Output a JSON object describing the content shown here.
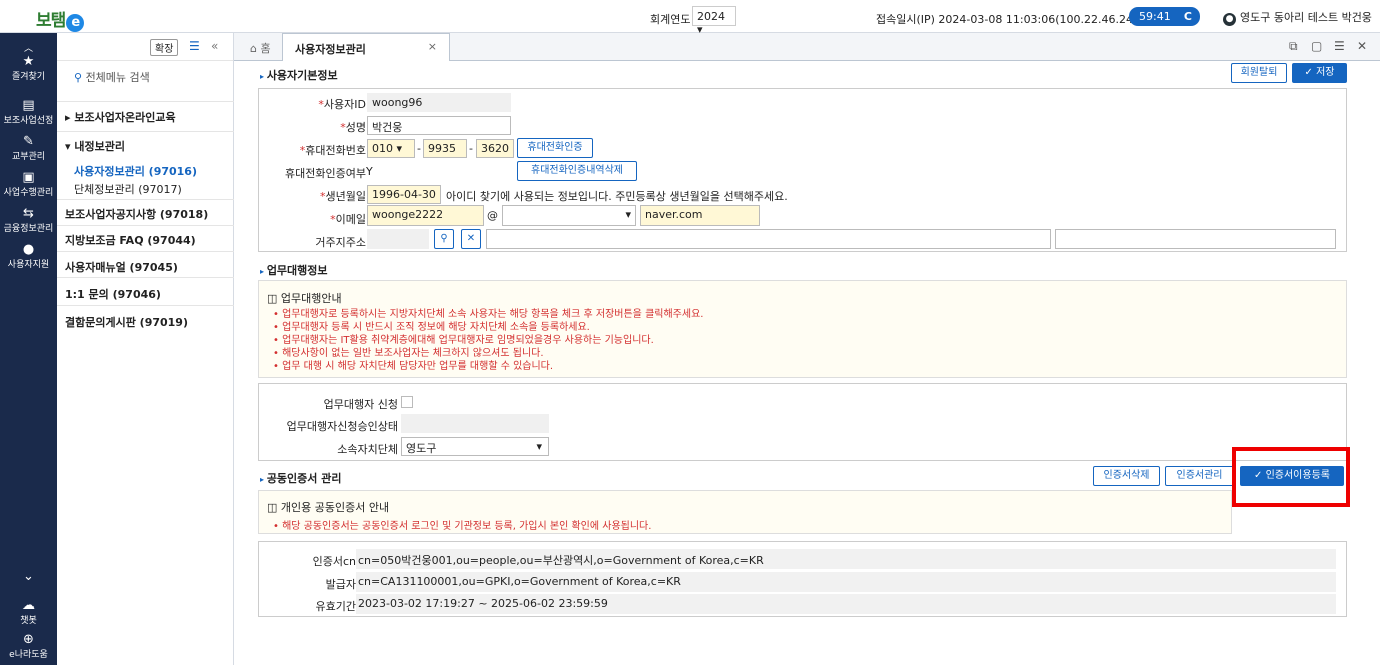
{
  "header": {
    "logo_text": "보탬",
    "logo_e": "e",
    "year_label": "회계연도",
    "year_value": "2024 ▾",
    "ip_info": "접속일시(IP)  2024-03-08 11:03:06(100.22.46.246)",
    "timer": "59:41",
    "timer_icon": "C",
    "user": "영도구 동아리 테스트 박건웅"
  },
  "leftbar": {
    "items": [
      {
        "label": "즐겨찾기",
        "icon": "★"
      },
      {
        "label": "보조사업선정",
        "icon": "▤"
      },
      {
        "label": "교부관리",
        "icon": "✎"
      },
      {
        "label": "사업수행관리",
        "icon": "▣"
      },
      {
        "label": "금융정보관리",
        "icon": "⇆"
      },
      {
        "label": "사용자지원",
        "icon": "●"
      }
    ],
    "down": "⌄",
    "chatbot": "챗봇",
    "help": "e나라도움"
  },
  "menu": {
    "expand": "확장",
    "search_placeholder": "전체메뉴 검색",
    "items": [
      "보조사업자온라인교육",
      "내정보관리",
      "사용자정보관리 (97016)",
      "단체정보관리 (97017)",
      "보조사업자공지사항 (97018)",
      "지방보조금 FAQ (97044)",
      "사용자매뉴얼 (97045)",
      "1:1 문의 (97046)",
      "결함문의게시판 (97019)"
    ]
  },
  "tabs": {
    "home": "홈",
    "active": "사용자정보관리",
    "close": "×"
  },
  "basic": {
    "title": "사용자기본정보",
    "withdraw": "회원탈퇴",
    "save": "✓ 저장",
    "labels": {
      "id": "사용자ID",
      "name": "성명",
      "phone": "휴대전화번호",
      "phone_verified": "휴대전화인증여부",
      "birth": "생년월일",
      "email": "이메일",
      "address": "거주지주소"
    },
    "id": "woong96",
    "name": "박건웅",
    "phone1": "010  ▾",
    "phone2": "9935",
    "phone3": "3620",
    "phone_btn": "휴대전화인증",
    "verified": "Y",
    "verify_del_btn": "휴대전화인증내역삭제",
    "birth": "1996-04-30",
    "birth_note": "아이디 찾기에 사용되는 정보입니다. 주민등록상 생년월일을 선택해주세요.",
    "email1": "woonge2222",
    "at": "@",
    "email_select": "▾",
    "email2": "naver.com"
  },
  "proxy": {
    "title": "업무대행정보",
    "notice_title": "업무대행안내",
    "notices": [
      "업무대행자로 등록하시는 지방자치단체 소속 사용자는 해당 항목을 체크 후 저장버튼을 클릭해주세요.",
      "업무대행자 등록 시 반드시 조직 정보에 해당 자치단체 소속을 등록하세요.",
      "업무대행자는 IT활용 취약계층에대해 업무대행자로 임명되었을경우 사용하는 기능입니다.",
      "해당사항이 없는 일반 보조사업자는 체크하지 않으셔도 됩니다.",
      "업무 대행 시 해당 자치단체 담당자만 업무를 대행할 수 있습니다."
    ],
    "apply_label": "업무대행자 신청",
    "status_label": "업무대행자신청승인상태",
    "org_label": "소속자치단체",
    "org_value": "영도구"
  },
  "cert": {
    "title": "공동인증서 관리",
    "del": "인증서삭제",
    "manage": "인증서관리",
    "register": "✓ 인증서이용등록",
    "notice_title": "개인용 공동인증서 안내",
    "notice": "해당 공동인증서는 공동인증서 로그인 및 기관정보 등록, 가입시 본인 확인에 사용됩니다.",
    "rows": [
      {
        "label": "인증서cn",
        "value": "cn=050박건웅001,ou=people,ou=부산광역시,o=Government of Korea,c=KR"
      },
      {
        "label": "발급자",
        "value": "cn=CA131100001,ou=GPKI,o=Government of Korea,c=KR"
      },
      {
        "label": "유효기간",
        "value": "2023-03-02 17:19:27 ~ 2025-06-02 23:59:59"
      }
    ]
  }
}
